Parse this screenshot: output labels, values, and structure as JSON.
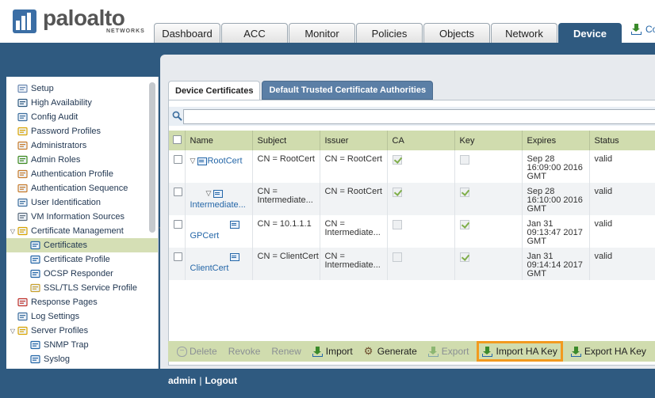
{
  "brand": {
    "word": "paloalto",
    "sub": "NETWORKS",
    "color": "#3b6ea5"
  },
  "tabs": [
    {
      "label": "Dashboard",
      "width": 84
    },
    {
      "label": "ACC",
      "width": 84
    },
    {
      "label": "Monitor",
      "width": 84
    },
    {
      "label": "Policies",
      "width": 84
    },
    {
      "label": "Objects",
      "width": 84
    },
    {
      "label": "Network",
      "width": 84
    },
    {
      "label": "Device",
      "width": 80,
      "active": true
    }
  ],
  "header": {
    "commit_label": "Co"
  },
  "nav": {
    "items": [
      {
        "label": "Setup",
        "icon": "setup-icon",
        "level": 0
      },
      {
        "label": "High Availability",
        "icon": "high-availability-icon",
        "level": 0
      },
      {
        "label": "Config Audit",
        "icon": "config-audit-icon",
        "level": 0
      },
      {
        "label": "Password Profiles",
        "icon": "key-icon",
        "level": 0
      },
      {
        "label": "Administrators",
        "icon": "user-icon",
        "level": 0
      },
      {
        "label": "Admin Roles",
        "icon": "admin-roles-icon",
        "level": 0
      },
      {
        "label": "Authentication Profile",
        "icon": "users-icon",
        "level": 0
      },
      {
        "label": "Authentication Sequence",
        "icon": "users-sequence-icon",
        "level": 0
      },
      {
        "label": "User Identification",
        "icon": "user-id-icon",
        "level": 0
      },
      {
        "label": "VM Information Sources",
        "icon": "monitor-icon",
        "level": 0
      },
      {
        "label": "Certificate Management",
        "icon": "folder-icon",
        "level": 0,
        "expanded": true
      },
      {
        "label": "Certificates",
        "icon": "certificate-icon",
        "level": 1,
        "selected": true
      },
      {
        "label": "Certificate Profile",
        "icon": "certificate-profile-icon",
        "level": 1
      },
      {
        "label": "OCSP Responder",
        "icon": "ocsp-icon",
        "level": 1
      },
      {
        "label": "SSL/TLS Service Profile",
        "icon": "lock-icon",
        "level": 1
      },
      {
        "label": "Response Pages",
        "icon": "response-pages-icon",
        "level": 0
      },
      {
        "label": "Log Settings",
        "icon": "log-settings-icon",
        "level": 0
      },
      {
        "label": "Server Profiles",
        "icon": "folder-icon",
        "level": 0,
        "expanded": true
      },
      {
        "label": "SNMP Trap",
        "icon": "snmp-icon",
        "level": 1
      },
      {
        "label": "Syslog",
        "icon": "syslog-icon",
        "level": 1
      }
    ]
  },
  "subtabs": {
    "active": "Device Certificates",
    "other": "Default Trusted Certificate Authorities"
  },
  "filter": {
    "value": "",
    "placeholder": ""
  },
  "table": {
    "headers": [
      "Name",
      "Subject",
      "Issuer",
      "CA",
      "Key",
      "Expires",
      "Status"
    ],
    "rows": [
      {
        "name": "RootCert",
        "indent": 0,
        "tree": true,
        "subject": "CN = RootCert",
        "issuer": "CN = RootCert",
        "ca": true,
        "key": false,
        "expires": [
          "Sep 28",
          "16:09:00 2016",
          "GMT"
        ],
        "status": "valid"
      },
      {
        "name": "Intermediate...",
        "indent": 1,
        "tree": true,
        "subject": "CN = Intermediate...",
        "issuer": "CN = RootCert",
        "ca": true,
        "key": true,
        "expires": [
          "Sep 28",
          "16:10:00 2016",
          "GMT"
        ],
        "status": "valid"
      },
      {
        "name": "GPCert",
        "indent": 2,
        "tree": false,
        "subject": "CN = 10.1.1.1",
        "issuer": "CN = Intermediate...",
        "ca": false,
        "key": true,
        "expires": [
          "Jan 31",
          "09:13:47 2017",
          "GMT"
        ],
        "status": "valid"
      },
      {
        "name": "ClientCert",
        "indent": 2,
        "tree": false,
        "subject": "CN = ClientCert",
        "issuer": "CN = Intermediate...",
        "ca": false,
        "key": true,
        "expires": [
          "Jan 31",
          "09:14:14 2017",
          "GMT"
        ],
        "status": "valid"
      }
    ]
  },
  "toolbar": {
    "delete": "Delete",
    "revoke": "Revoke",
    "renew": "Renew",
    "import": "Import",
    "generate": "Generate",
    "export": "Export",
    "import_ha_key": "Import HA Key",
    "export_ha_key": "Export HA Key"
  },
  "footer": {
    "user": "admin",
    "logout": "Logout"
  },
  "colors": {
    "accent": "#2f5a80",
    "header_green": "#d0dcae",
    "highlight": "#f29a1f",
    "valid": "#3d8a1e"
  }
}
